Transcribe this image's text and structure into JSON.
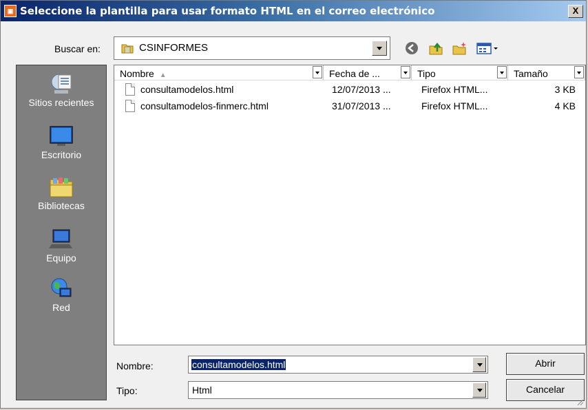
{
  "window": {
    "title": "Seleccione la plantilla para usar formato HTML en el correo electrónico",
    "app_icon": "app-icon",
    "close_glyph": "X"
  },
  "lookin": {
    "label": "Buscar en:",
    "value": "CSINFORMES",
    "icon": "folder-icon"
  },
  "toolbar": {
    "back_icon": "back-icon",
    "up_icon": "up-folder-icon",
    "new_folder_icon": "new-folder-icon",
    "views_icon": "views-menu-icon"
  },
  "places": [
    {
      "label": "Sitios recientes",
      "icon": "recent-places-icon"
    },
    {
      "label": "Escritorio",
      "icon": "desktop-icon"
    },
    {
      "label": "Bibliotecas",
      "icon": "libraries-icon"
    },
    {
      "label": "Equipo",
      "icon": "computer-icon"
    },
    {
      "label": "Red",
      "icon": "network-icon"
    }
  ],
  "columns": [
    "Nombre",
    "Fecha de ...",
    "Tipo",
    "Tamaño"
  ],
  "files": [
    {
      "name": "consultamodelos.html",
      "date": "12/07/2013 ...",
      "type": "Firefox HTML...",
      "size": "3 KB"
    },
    {
      "name": "consultamodelos-finmerc.html",
      "date": "31/07/2013 ...",
      "type": "Firefox HTML...",
      "size": "4 KB"
    }
  ],
  "filename": {
    "label": "Nombre:",
    "value": "consultamodelos.html"
  },
  "filetype": {
    "label": "Tipo:",
    "value": "Html"
  },
  "buttons": {
    "open": "Abrir",
    "cancel": "Cancelar"
  }
}
